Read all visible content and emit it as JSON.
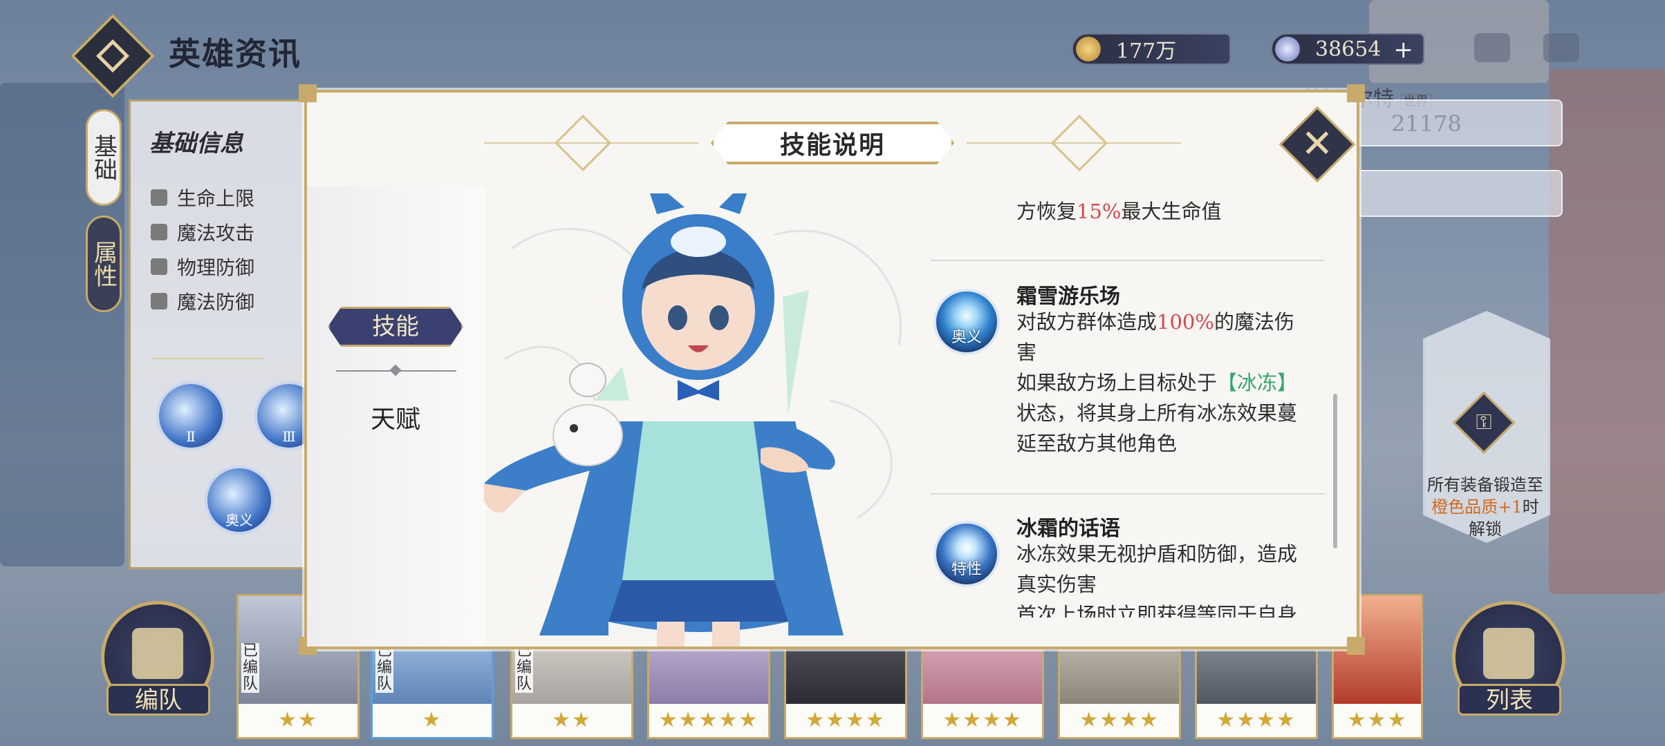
{
  "header": {
    "title": "英雄资讯"
  },
  "resources": {
    "gold": "177万",
    "gems": "38654",
    "gem_plus": "+"
  },
  "side_tabs": [
    {
      "label": "基础"
    },
    {
      "label": "属性"
    }
  ],
  "left_panel": {
    "title": "基础信息",
    "stats": [
      {
        "label": "生命上限"
      },
      {
        "label": "魔法攻击"
      },
      {
        "label": "物理防御"
      },
      {
        "label": "魔法防御"
      }
    ],
    "orb_labels": [
      "Ⅱ",
      "Ⅲ",
      "奥义"
    ]
  },
  "right_panel": {
    "player_name": "叫兰耶尔特",
    "world_tag": "世界",
    "power": "21178"
  },
  "lock_panel": {
    "line1": "所有装备锻造至",
    "highlight": "橙色品质+1",
    "line2": "时解锁"
  },
  "bottom": {
    "team_button": "编队",
    "list_button": "列表",
    "heroes": [
      {
        "stars": "★★",
        "tag": "已编队"
      },
      {
        "stars": "★",
        "tag": "已编队"
      },
      {
        "stars": "★★",
        "tag": "已编队"
      },
      {
        "stars": "★★★★★",
        "tag": ""
      },
      {
        "stars": "★★★★",
        "tag": ""
      },
      {
        "stars": "★★★★",
        "tag": ""
      },
      {
        "stars": "★★★★",
        "tag": ""
      },
      {
        "stars": "★★★★",
        "tag": ""
      },
      {
        "stars": "★★★",
        "tag": ""
      }
    ]
  },
  "modal": {
    "title": "技能说明",
    "close_glyph": "✕",
    "tabs": {
      "active": "技能",
      "inactive": "天赋"
    },
    "skills": {
      "partial_top": {
        "prefix": "方恢复",
        "value": "15%",
        "suffix": "最大生命值"
      },
      "skill1": {
        "badge": "奥义",
        "name": "霜雪游乐场",
        "line_a_prefix": "对敌方群体造成",
        "line_a_value": "100%",
        "line_a_suffix": "的魔法伤",
        "line_b": "害",
        "line_c_prefix": "如果敌方场上目标处于",
        "line_c_keyword": "【冰冻】",
        "line_d": "状态，将其身上所有冰冻效果蔓",
        "line_e": "延至敌方其他角色"
      },
      "skill2": {
        "badge": "特性",
        "name": "冰霜的话语",
        "line_a": "冰冻效果无视护盾和防御，造成",
        "line_b": "真实伤害",
        "line_c": "首次上场时立即获得等同于自身"
      }
    }
  },
  "colors": {
    "gold_border": "#c8aa6a",
    "navy": "#3a4070",
    "damage_red": "#d9464a",
    "keyword_green": "#38a46c"
  }
}
